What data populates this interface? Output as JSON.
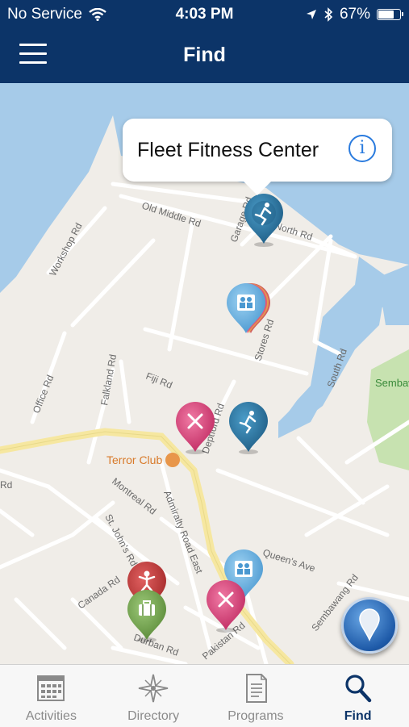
{
  "status_bar": {
    "carrier": "No Service",
    "time": "4:03 PM",
    "battery": "67%",
    "battery_level": 0.67
  },
  "nav": {
    "title": "Find",
    "menu_icon": "hamburger-menu-icon"
  },
  "map": {
    "callout_title": "Fleet Fitness Center",
    "place_label": "Terror Club",
    "roads": [
      "Old Middle Rd",
      "Garage Rd",
      "North Rd",
      "Workshop Rd",
      "Stores Rd",
      "South Rd",
      "Office Rd",
      "Fiji Rd",
      "Falkland Rd",
      "Deptford Rd",
      "Montreal Rd",
      "Admiralty Road East",
      "St. John's Rd",
      "Canada Rd",
      "Queen's Ave",
      "Durban Rd",
      "Pakistan Rd",
      "Sembawang Rd",
      "Rd",
      "Sembawang"
    ],
    "colors": {
      "water": "#a6cbe9",
      "land": "#f0ede8",
      "park": "#c7e2b0",
      "pin_fitness": "#2c7aa8",
      "pin_family": "#6cb4e4",
      "pin_dining": "#e0487f",
      "pin_kids": "#c83b3b",
      "pin_travel": "#7aaa55"
    }
  },
  "tabs": [
    {
      "label": "Activities",
      "icon": "calendar-icon",
      "active": false
    },
    {
      "label": "Directory",
      "icon": "compass-icon",
      "active": false
    },
    {
      "label": "Programs",
      "icon": "document-icon",
      "active": false
    },
    {
      "label": "Find",
      "icon": "search-icon",
      "active": true
    }
  ]
}
